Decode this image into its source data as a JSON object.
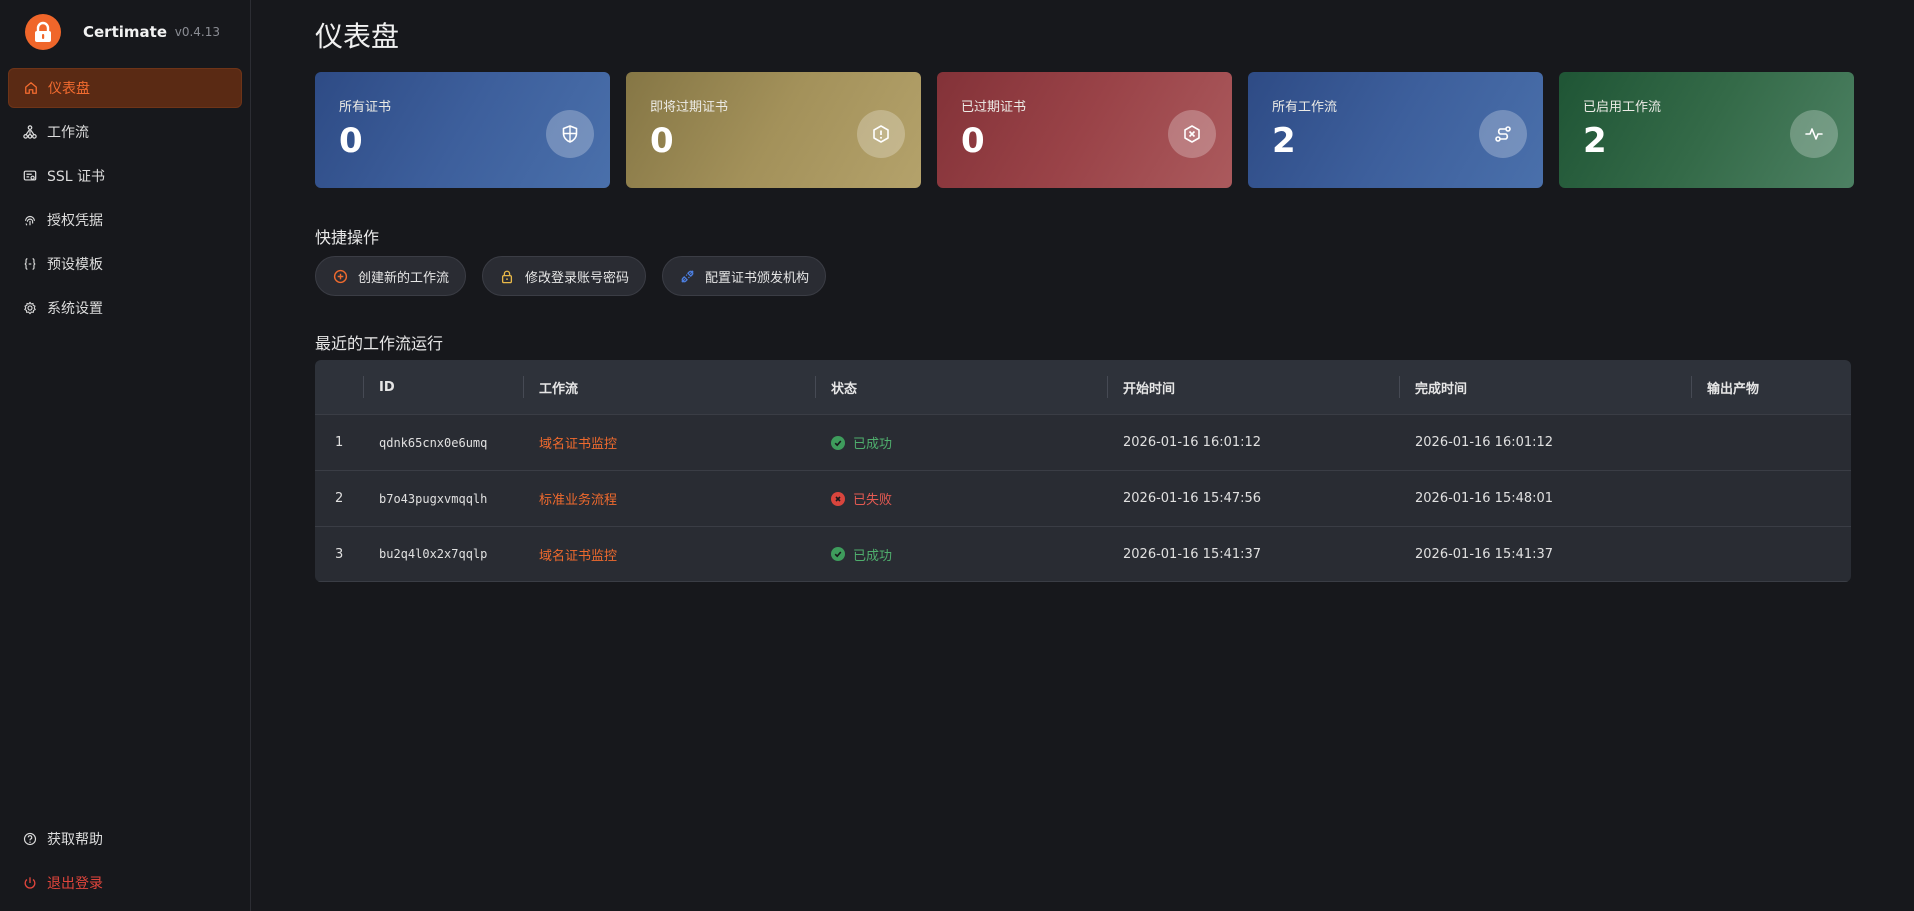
{
  "brand": {
    "name": "Certimate",
    "version": "v0.4.13"
  },
  "sidebar": {
    "items": [
      {
        "label": "仪表盘",
        "icon": "home-icon",
        "active": true
      },
      {
        "label": "工作流",
        "icon": "workflow-icon"
      },
      {
        "label": "SSL 证书",
        "icon": "certificate-icon"
      },
      {
        "label": "授权凭据",
        "icon": "fingerprint-icon"
      },
      {
        "label": "预设模板",
        "icon": "braces-icon"
      },
      {
        "label": "系统设置",
        "icon": "gear-icon"
      }
    ],
    "bottom": [
      {
        "label": "获取帮助",
        "icon": "help-icon"
      },
      {
        "label": "退出登录",
        "icon": "power-icon"
      }
    ]
  },
  "main": {
    "title": "仪表盘",
    "stats": [
      {
        "label": "所有证书",
        "value": "0",
        "icon": "shield-icon",
        "color": "#3d5f9c"
      },
      {
        "label": "即将过期证书",
        "value": "0",
        "icon": "alert-icon",
        "color": "#a3915a"
      },
      {
        "label": "已过期证书",
        "value": "0",
        "icon": "hexagon-x-icon",
        "color": "#9a4348"
      },
      {
        "label": "所有工作流",
        "value": "2",
        "icon": "route-icon",
        "color": "#3d5f9c"
      },
      {
        "label": "已启用工作流",
        "value": "2",
        "icon": "activity-icon",
        "color": "#346a48"
      }
    ],
    "quick_title": "快捷操作",
    "quick_actions": [
      {
        "label": "创建新的工作流",
        "icon": "plus-circle-icon",
        "color": "#ef6a2e"
      },
      {
        "label": "修改登录账号密码",
        "icon": "lock-icon",
        "color": "#e9b949"
      },
      {
        "label": "配置证书颁发机构",
        "icon": "plug-icon",
        "color": "#4c7fe0"
      }
    ],
    "runs_title": "最近的工作流运行",
    "table": {
      "columns": [
        "",
        "ID",
        "工作流",
        "状态",
        "开始时间",
        "完成时间",
        "输出产物"
      ],
      "rows": [
        {
          "num": "1",
          "id": "qdnk65cnx0e6umq",
          "workflow": "域名证书监控",
          "status": "已成功",
          "status_type": "ok",
          "start": "2026-01-16 16:01:12",
          "end": "2026-01-16 16:01:12",
          "output": ""
        },
        {
          "num": "2",
          "id": "b7o43pugxvmqqlh",
          "workflow": "标准业务流程",
          "status": "已失败",
          "status_type": "fail",
          "start": "2026-01-16 15:47:56",
          "end": "2026-01-16 15:48:01",
          "output": ""
        },
        {
          "num": "3",
          "id": "bu2q4l0x2x7qqlp",
          "workflow": "域名证书监控",
          "status": "已成功",
          "status_type": "ok",
          "start": "2026-01-16 15:41:37",
          "end": "2026-01-16 15:41:37",
          "output": ""
        }
      ]
    }
  }
}
